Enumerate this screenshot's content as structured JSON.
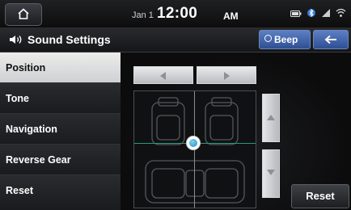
{
  "status": {
    "date": "Jan 1",
    "time": "12:00",
    "ampm": "AM",
    "icons": [
      "bluetooth-battery-icon",
      "bluetooth-icon",
      "signal-icon",
      "wifi-icon"
    ]
  },
  "header": {
    "title": "Sound Settings",
    "beep_label": "Beep",
    "back_icon": "back-arrow-icon"
  },
  "sidebar": {
    "items": [
      {
        "label": "Position",
        "active": true
      },
      {
        "label": "Tone",
        "active": false
      },
      {
        "label": "Navigation",
        "active": false
      },
      {
        "label": "Reverse Gear",
        "active": false
      },
      {
        "label": "Reset",
        "active": false
      }
    ]
  },
  "position_panel": {
    "balance_center": "center",
    "fader_center": "slightly rear",
    "reset_label": "Reset"
  },
  "colors": {
    "accent_blue": "#4a6fb8",
    "crosshair": "#2a9a7a",
    "knob": "#3fb5d9"
  }
}
